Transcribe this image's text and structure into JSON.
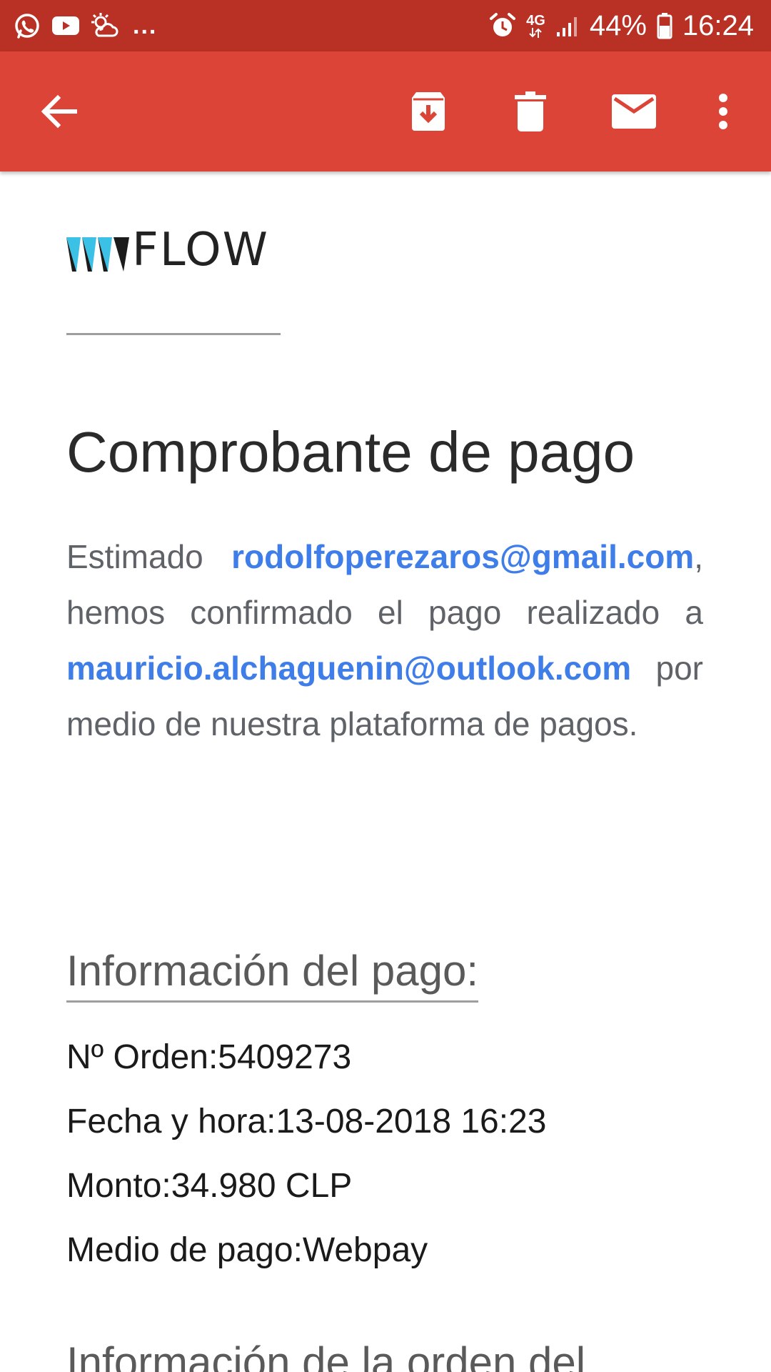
{
  "status_bar": {
    "left_icons": [
      "whatsapp-icon",
      "youtube-icon",
      "weather-icon"
    ],
    "overflow": "...",
    "alarm_icon": "alarm-icon",
    "network_type": "4G",
    "battery_percent": "44%",
    "time": "16:24"
  },
  "toolbar": {
    "icons": [
      "back-arrow-icon",
      "archive-icon",
      "delete-icon",
      "mark-unread-icon",
      "more-vert-icon"
    ]
  },
  "email": {
    "logo_text": "FLOW",
    "title": "Comprobante de pago",
    "intro": {
      "part1": "Estimado ",
      "payer_email": "rodolfoperezaros@gmail.com",
      "part2": ", hemos confirmado el pago realizado a ",
      "payee_email": "mauricio.alchaguenin@outlook.com",
      "part3": " por medio de nuestra plataforma de pagos."
    },
    "payment_info": {
      "heading": "Información del pago:",
      "rows": [
        {
          "label": "Nº Orden:",
          "value": "5409273"
        },
        {
          "label": "Fecha y hora:",
          "value": "13-08-2018 16:23"
        },
        {
          "label": "Monto:",
          "value": "34.980 CLP"
        },
        {
          "label": "Medio de pago:",
          "value": "Webpay"
        }
      ]
    },
    "next_heading": "Información de la orden del"
  },
  "colors": {
    "status_bar": "#b93124",
    "app_bar": "#db4437",
    "link": "#3f7ee8",
    "logo_accent": "#3cc1e6"
  }
}
